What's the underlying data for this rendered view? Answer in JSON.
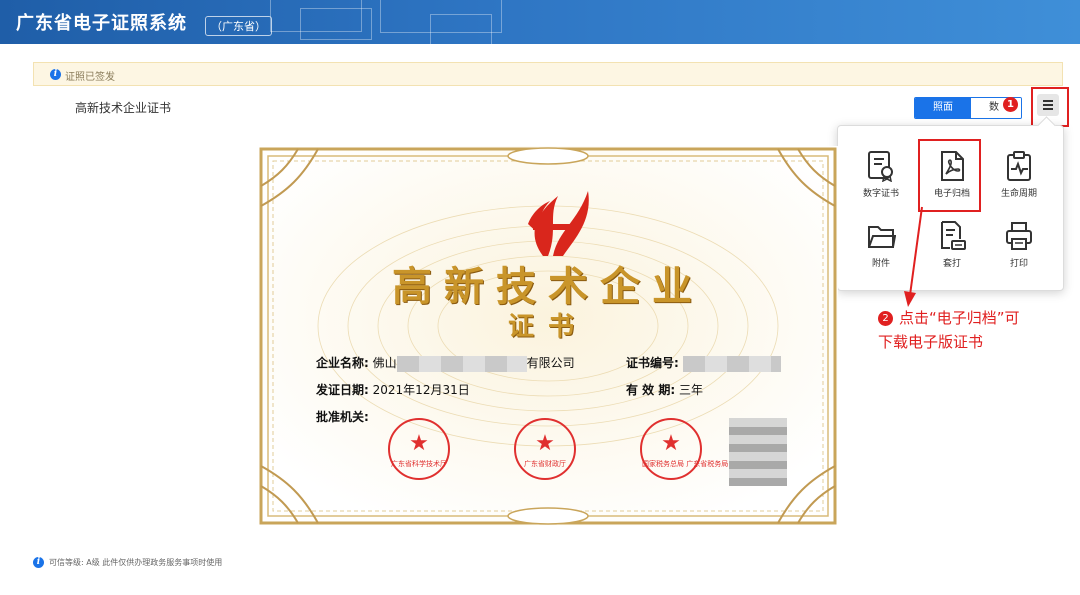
{
  "app": {
    "title": "广东省电子证照系统",
    "region": "（广东省）"
  },
  "notice": {
    "text": "证照已签发",
    "icon": "info-icon"
  },
  "page": {
    "title": "高新技术企业证书"
  },
  "view_toggle": {
    "active": "照面",
    "inactive_visible": "数"
  },
  "annotations": {
    "step1": "1",
    "step2": "2",
    "callout_line1": "点击“电子归档”可",
    "callout_line2": "下载电子版证书"
  },
  "menu": {
    "items": [
      {
        "label": "数字证书",
        "icon": "certificate-icon"
      },
      {
        "label": "电子归档",
        "icon": "pdf-icon"
      },
      {
        "label": "生命周期",
        "icon": "lifecycle-icon"
      },
      {
        "label": "附件",
        "icon": "folder-icon"
      },
      {
        "label": "套打",
        "icon": "overprint-icon"
      },
      {
        "label": "打印",
        "icon": "printer-icon"
      }
    ]
  },
  "certificate": {
    "heading": "高新技术企业",
    "subheading": "证书",
    "name_label": "企业名称:",
    "name_prefix": "佛山",
    "name_suffix": "有限公司",
    "number_label": "证书编号:",
    "date_label": "发证日期:",
    "date_value": "2021年12月31日",
    "validity_label": "有 效 期:",
    "validity_value": "三年",
    "authority_label": "批准机关:",
    "seals": [
      "广东省科学技术厅",
      "广东省财政厅",
      "国家税务总局 广东省税务局"
    ]
  },
  "footer": {
    "text": "可信等级:  A级 此件仅供办理政务服务事项时使用"
  },
  "colors": {
    "accent": "#1a73e8",
    "alert": "#e02020",
    "banner": "#2e75c3",
    "gold": "#c9952a"
  }
}
